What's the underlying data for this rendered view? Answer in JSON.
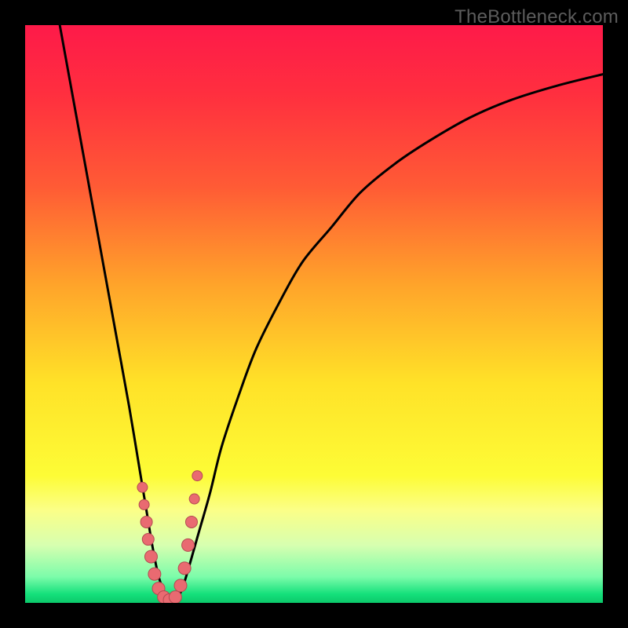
{
  "watermark": "TheBottleneck.com",
  "colors": {
    "frame": "#000000",
    "curve": "#000000",
    "markers_fill": "#e96a71",
    "markers_stroke": "#b34b51",
    "gradient_stops": [
      {
        "offset": 0.0,
        "color": "#fe1a49"
      },
      {
        "offset": 0.12,
        "color": "#ff2f3f"
      },
      {
        "offset": 0.28,
        "color": "#ff5b35"
      },
      {
        "offset": 0.45,
        "color": "#ffa42a"
      },
      {
        "offset": 0.62,
        "color": "#ffe228"
      },
      {
        "offset": 0.78,
        "color": "#fdfc36"
      },
      {
        "offset": 0.84,
        "color": "#fbff88"
      },
      {
        "offset": 0.9,
        "color": "#d7ffb0"
      },
      {
        "offset": 0.955,
        "color": "#7cfcaa"
      },
      {
        "offset": 0.985,
        "color": "#14e07b"
      },
      {
        "offset": 1.0,
        "color": "#0cc86a"
      }
    ]
  },
  "chart_data": {
    "type": "line",
    "title": "",
    "xlabel": "",
    "ylabel": "",
    "xlim": [
      0,
      100
    ],
    "ylim": [
      0,
      100
    ],
    "series": [
      {
        "name": "bottleneck-curve",
        "x": [
          6,
          8,
          10,
          12,
          14,
          16,
          18,
          20,
          21,
          22,
          23,
          24,
          25,
          26,
          27,
          28,
          30,
          32,
          34,
          37,
          40,
          44,
          48,
          53,
          58,
          64,
          70,
          77,
          84,
          92,
          100
        ],
        "y": [
          100,
          89,
          78,
          67,
          56,
          45,
          34,
          22,
          16,
          10,
          5,
          2,
          0.5,
          0.5,
          2,
          5,
          12,
          19,
          27,
          36,
          44,
          52,
          59,
          65,
          71,
          76,
          80,
          84,
          87,
          89.5,
          91.5
        ]
      }
    ],
    "markers": {
      "name": "highlighted-points",
      "x": [
        20.3,
        20.6,
        21.0,
        21.3,
        21.8,
        22.4,
        23.1,
        24.0,
        25.0,
        26.0,
        26.9,
        27.6,
        28.2,
        28.8,
        29.3,
        29.8
      ],
      "y": [
        20.0,
        17.0,
        14.0,
        11.0,
        8.0,
        5.0,
        2.5,
        1.0,
        0.5,
        1.0,
        3.0,
        6.0,
        10.0,
        14.0,
        18.0,
        22.0
      ],
      "r": [
        6.5,
        6.5,
        7.5,
        7.5,
        8.0,
        8.0,
        8.0,
        8.0,
        8.0,
        8.0,
        8.0,
        8.0,
        8.0,
        7.5,
        6.5,
        6.5
      ]
    }
  }
}
